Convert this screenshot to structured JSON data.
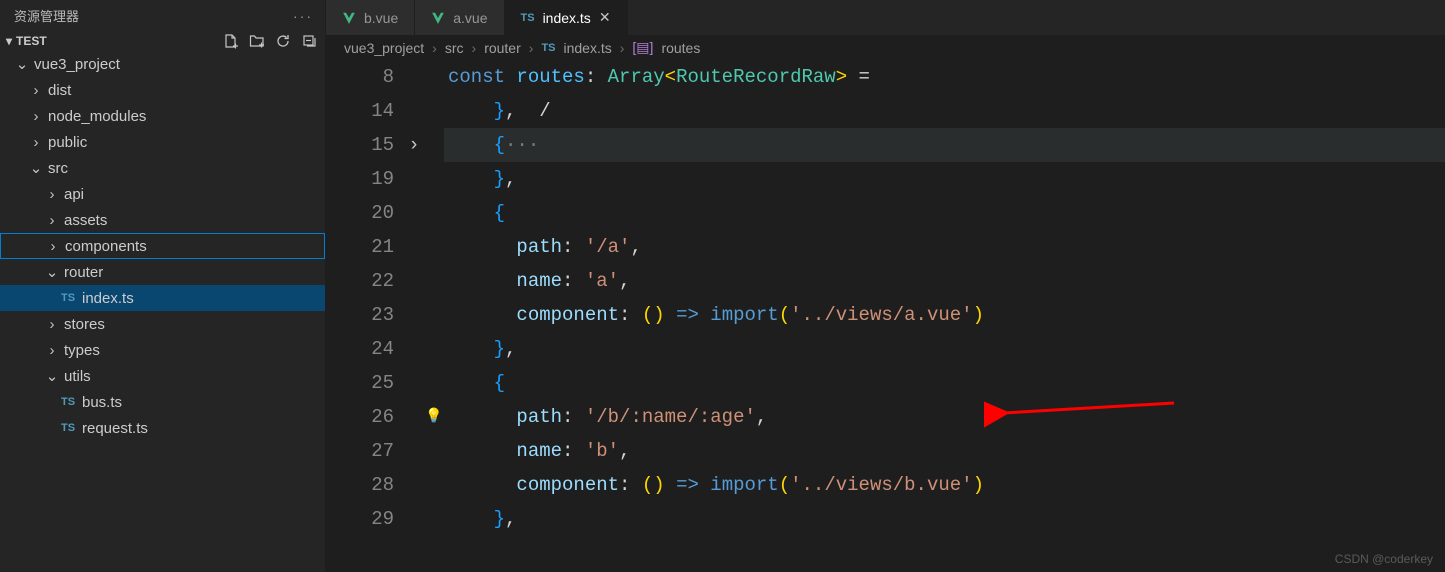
{
  "sidebar": {
    "title": "资源管理器",
    "section": "TEST",
    "root": "vue3_project",
    "items": [
      "dist",
      "node_modules",
      "public",
      "src",
      "api",
      "assets",
      "components",
      "router",
      "index.ts",
      "stores",
      "types",
      "utils",
      "bus.ts",
      "request.ts"
    ]
  },
  "tabs": {
    "t0": "b.vue",
    "t1": "a.vue",
    "t2": "index.ts"
  },
  "breadcrumb": {
    "p0": "vue3_project",
    "p1": "src",
    "p2": "router",
    "p3": "index.ts",
    "p4": "routes"
  },
  "code": {
    "sticky_ln": "8",
    "sticky": {
      "const": "const",
      "routes": "routes",
      "colon": ":",
      "array": "Array",
      "generic": "RouteRecordRaw",
      "eq": "="
    },
    "lines": [
      "14",
      "15",
      "19",
      "20",
      "21",
      "22",
      "23",
      "24",
      "25",
      "26",
      "27",
      "28",
      "29"
    ],
    "ln14": {
      "brace": "}",
      "comma": ",",
      "slash": "/"
    },
    "ln15": {
      "brace": "{",
      "dots": "···"
    },
    "ln19": {
      "brace": "}",
      "comma": ","
    },
    "ln20": {
      "brace": "{"
    },
    "ln21": {
      "path": "path",
      "colon": ":",
      "val": "'/a'",
      "comma": ","
    },
    "ln22": {
      "name": "name",
      "colon": ":",
      "val": "'a'",
      "comma": ","
    },
    "ln23": {
      "comp": "component",
      "colon": ":",
      "lp": "(",
      "rp": ")",
      "arrow": "=>",
      "import": "import",
      "lp2": "(",
      "val": "'../views/a.vue'",
      "rp2": ")"
    },
    "ln24": {
      "brace": "}",
      "comma": ","
    },
    "ln25": {
      "brace": "{"
    },
    "ln26": {
      "path": "path",
      "colon": ":",
      "val": "'/b/:name/:age'",
      "comma": ","
    },
    "ln27": {
      "name": "name",
      "colon": ":",
      "val": "'b'",
      "comma": ","
    },
    "ln28": {
      "comp": "component",
      "colon": ":",
      "lp": "(",
      "rp": ")",
      "arrow": "=>",
      "import": "import",
      "lp2": "(",
      "val": "'../views/b.vue'",
      "rp2": ")"
    },
    "ln29": {
      "brace": "}",
      "comma": ","
    }
  },
  "watermark": "CSDN @coderkey"
}
